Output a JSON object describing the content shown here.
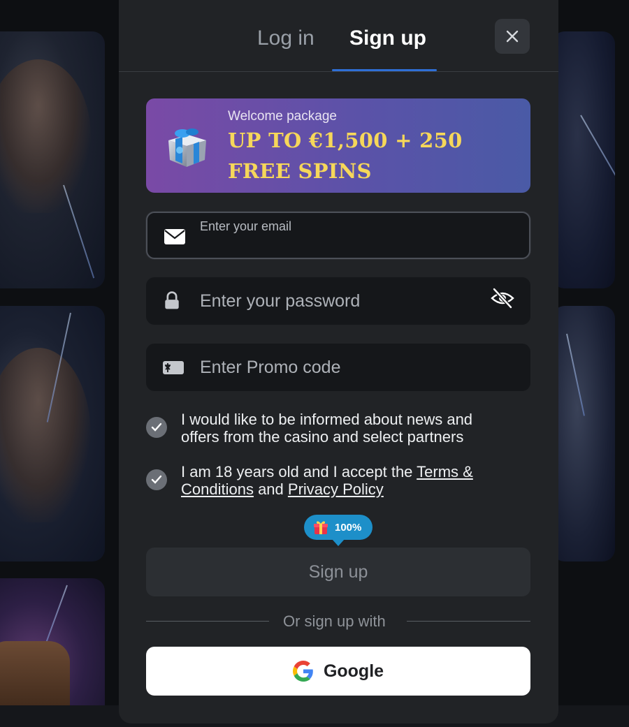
{
  "tabs": {
    "login": "Log in",
    "signup": "Sign up",
    "active": "signup"
  },
  "banner": {
    "subtitle": "Welcome package",
    "headline": "UP TO €1,500 + 250 FREE SPINS"
  },
  "form": {
    "email": {
      "label": "Enter your email",
      "value": ""
    },
    "password": {
      "placeholder": "Enter your password",
      "value": ""
    },
    "promo": {
      "placeholder": "Enter Promo code",
      "value": ""
    }
  },
  "consents": {
    "news": {
      "checked": true,
      "text": "I would like to be informed about news and offers from the casino and select partners"
    },
    "terms": {
      "checked": true,
      "prefix": "I am 18 years old and I accept the ",
      "terms_link": "Terms & Conditions",
      "middle": " and ",
      "privacy_link": "Privacy Policy"
    }
  },
  "bonus_badge": {
    "icon": "gift-icon",
    "value": "100%"
  },
  "buttons": {
    "signup": "Sign up",
    "google": "Google"
  },
  "divider_text": "Or sign up with",
  "colors": {
    "accent_tab": "#2f6fd6",
    "banner_gold": "#f6d75a",
    "badge_blue": "#1d8fc9"
  }
}
